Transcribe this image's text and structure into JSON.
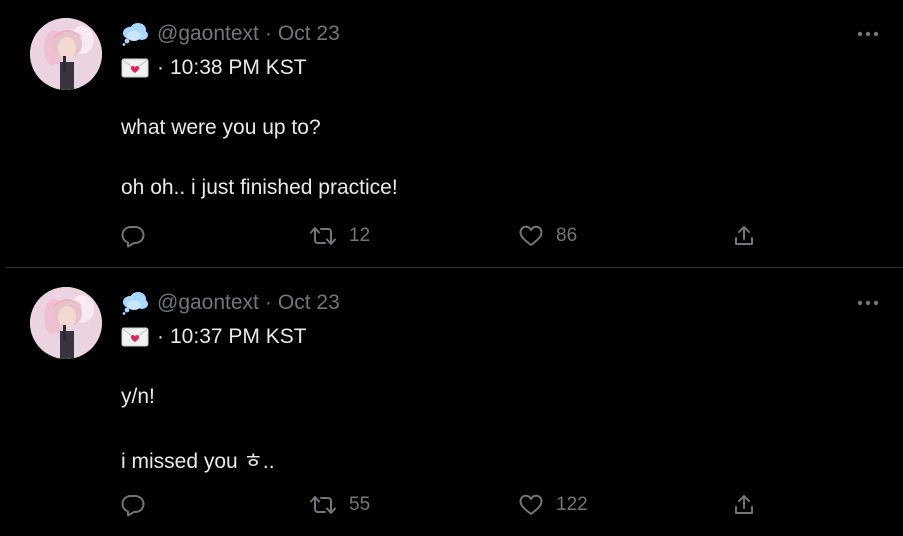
{
  "tweets": [
    {
      "handle": "@gaontext",
      "separator": "·",
      "date": "Oct 23",
      "time_separator": "·",
      "time": "10:38 PM KST",
      "lines": [
        "what were you up to?",
        "oh oh.. i just finished practice!"
      ],
      "retweets": "12",
      "likes": "86"
    },
    {
      "handle": "@gaontext",
      "separator": "·",
      "date": "Oct 23",
      "time_separator": "·",
      "time": "10:37 PM KST",
      "lines": [
        "y/n!",
        "i missed you ㅎ.."
      ],
      "retweets": "55",
      "likes": "122"
    }
  ],
  "icons": {
    "header_emoji": "thought-balloon-icon",
    "time_emoji": "love-letter-icon",
    "more": "more-horizontal-icon",
    "reply": "reply-icon",
    "retweet": "retweet-icon",
    "like": "heart-icon",
    "share": "share-icon"
  },
  "colors": {
    "background": "#000000",
    "text_primary": "#e7e9ea",
    "text_secondary": "#71767b",
    "divider": "#2f3336",
    "balloon": "#a8d8ff",
    "envelope_heart": "#e0245e"
  }
}
